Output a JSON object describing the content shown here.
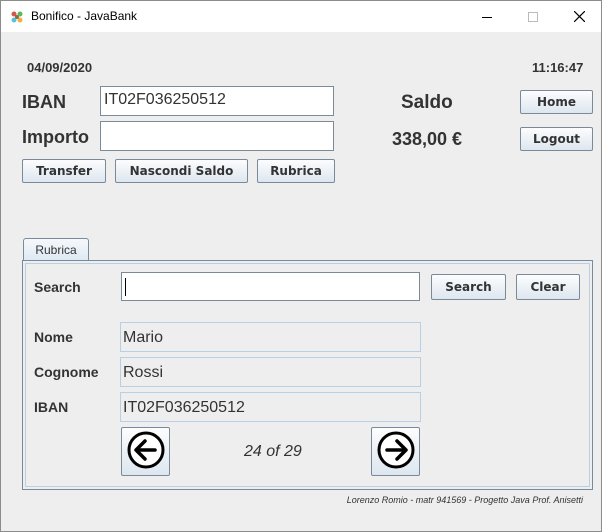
{
  "window": {
    "title": "Bonifico - JavaBank",
    "controls": [
      "minimize",
      "maximize",
      "close"
    ]
  },
  "header": {
    "date": "04/09/2020",
    "time": "11:16:47"
  },
  "transfer": {
    "iban_label": "IBAN",
    "iban_value": "IT02F036250512",
    "importo_label": "Importo",
    "importo_value": "",
    "transfer_button": "Transfer",
    "hide_balance_button": "Nascondi Saldo",
    "rubrica_button": "Rubrica"
  },
  "balance": {
    "label": "Saldo",
    "amount": "338,00 €"
  },
  "nav": {
    "home_button": "Home",
    "logout_button": "Logout"
  },
  "rubrica": {
    "tab_label": "Rubrica",
    "search_label": "Search",
    "search_value": "",
    "search_button": "Search",
    "clear_button": "Clear",
    "fields": {
      "nome_label": "Nome",
      "nome_value": "Mario",
      "cognome_label": "Cognome",
      "cognome_value": "Rossi",
      "iban_label": "IBAN",
      "iban_value": "IT02F036250512"
    },
    "pager": "24 of 29",
    "prev_icon": "arrow-left-circle-icon",
    "next_icon": "arrow-right-circle-icon"
  },
  "footer": {
    "credits": "Lorenzo Romio - matr 941569 - Progetto Java Prof. Anisetti"
  },
  "colors": {
    "window_bg": "#eeeeee",
    "button_border": "#7a8a99",
    "field_border": "#b8cfe5"
  }
}
